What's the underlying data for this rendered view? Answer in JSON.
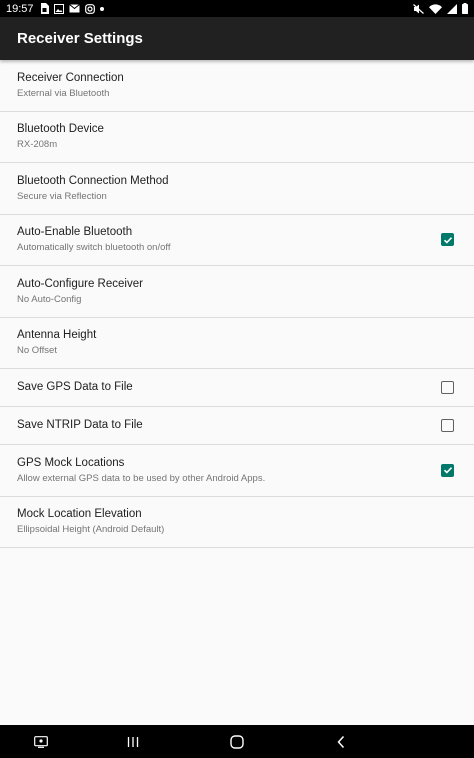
{
  "status_bar": {
    "time": "19:57",
    "left_icons": [
      "sim-card-icon",
      "image-icon",
      "email-icon",
      "instagram-icon",
      "dot-icon"
    ],
    "right_icons": [
      "mute-icon",
      "wifi-icon",
      "signal-icon",
      "battery-icon"
    ]
  },
  "app_bar": {
    "title": "Receiver Settings"
  },
  "preferences": [
    {
      "title": "Receiver Connection",
      "summary": "External via Bluetooth"
    },
    {
      "title": "Bluetooth Device",
      "summary": "RX-208m"
    },
    {
      "title": "Bluetooth Connection Method",
      "summary": "Secure via Reflection"
    },
    {
      "title": "Auto-Enable Bluetooth",
      "summary": "Automatically switch bluetooth on/off",
      "checked": true
    },
    {
      "title": "Auto-Configure Receiver",
      "summary": "No Auto-Config"
    },
    {
      "title": "Antenna Height",
      "summary": "No Offset"
    },
    {
      "title": "Save GPS Data to File",
      "checked": false
    },
    {
      "title": "Save NTRIP Data to File",
      "checked": false
    },
    {
      "title": "GPS Mock Locations",
      "summary": "Allow external GPS data to be used by other Android Apps.",
      "checked": true
    },
    {
      "title": "Mock Location Elevation",
      "summary": "Ellipsoidal Height (Android Default)"
    }
  ],
  "colors": {
    "app_bar": "#212121",
    "accent": "#00796b",
    "background": "#fafafa"
  },
  "nav_bar": {
    "icons": [
      "screenshot-icon",
      "recent-apps-icon",
      "home-icon",
      "back-icon"
    ]
  }
}
